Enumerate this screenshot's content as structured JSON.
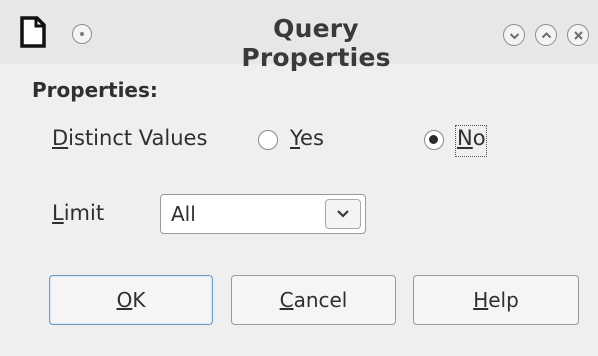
{
  "window": {
    "title": "Query Properties"
  },
  "properties": {
    "heading": "Properties:",
    "distinct_values": {
      "label_mnemonic": "D",
      "label_rest": "istinct Values",
      "yes": {
        "mnemonic": "Y",
        "rest": "es",
        "checked": false
      },
      "no": {
        "mnemonic": "N",
        "rest": "o",
        "checked": true
      }
    },
    "limit": {
      "label_mnemonic": "L",
      "label_rest": "imit",
      "value": "All"
    }
  },
  "buttons": {
    "ok": {
      "mnemonic": "O",
      "rest": "K"
    },
    "cancel": {
      "mnemonic": "C",
      "rest": "ancel"
    },
    "help": {
      "mnemonic": "H",
      "rest": "elp"
    }
  },
  "icons": {
    "app": "document-icon",
    "window_menu": "window-menu-icon",
    "minimize": "chevron-down-icon",
    "maximize": "chevron-up-icon",
    "close": "close-icon",
    "dropdown": "chevron-down-icon"
  },
  "colors": {
    "window_bg": "#efefef",
    "titlebar_bg": "#e7e7e7",
    "default_button_border": "#6f9cc9",
    "text": "#2f2f2f"
  }
}
